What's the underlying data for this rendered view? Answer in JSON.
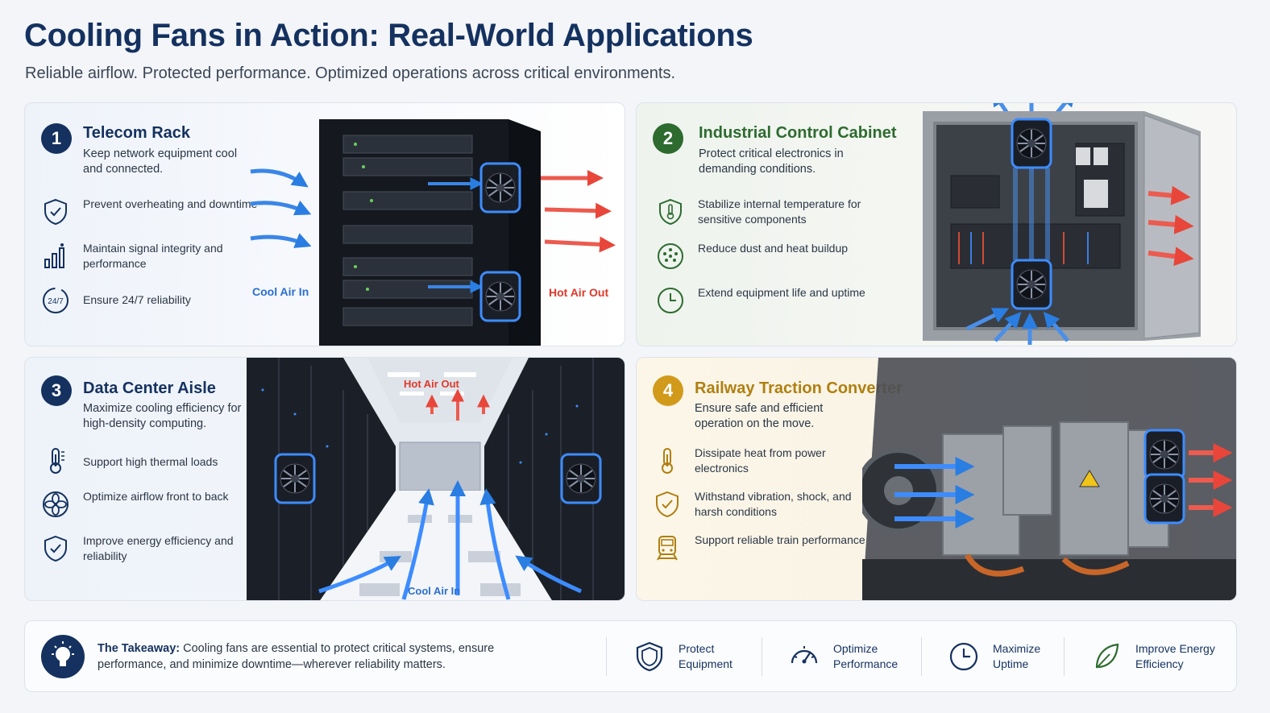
{
  "header": {
    "title": "Cooling Fans in Action: Real-World Applications",
    "subtitle": "Reliable airflow. Protected performance. Optimized operations across critical environments."
  },
  "cards": [
    {
      "number": "1",
      "title": "Telecom Rack",
      "desc": "Keep network equipment cool and connected.",
      "features": [
        {
          "icon": "shield-check-icon",
          "text": "Prevent overheating and downtime"
        },
        {
          "icon": "signal-bars-icon",
          "text": "Maintain signal integrity and performance"
        },
        {
          "icon": "clock-247-icon",
          "text": "Ensure 24/7 reliability"
        }
      ],
      "labels": {
        "cool": "Cool Air In",
        "hot": "Hot Air Out"
      },
      "accent": "#14315f"
    },
    {
      "number": "2",
      "title": "Industrial Control Cabinet",
      "desc": "Protect critical electronics in demanding conditions.",
      "features": [
        {
          "icon": "shield-thermometer-icon",
          "text": "Stabilize internal temperature for sensitive components"
        },
        {
          "icon": "dust-icon",
          "text": "Reduce dust and heat buildup"
        },
        {
          "icon": "clock-icon",
          "text": "Extend equipment life and uptime"
        }
      ],
      "accent": "#2d6b2f"
    },
    {
      "number": "3",
      "title": "Data Center Aisle",
      "desc": "Maximize cooling efficiency for high-density computing.",
      "features": [
        {
          "icon": "thermometer-icon",
          "text": "Support high thermal loads"
        },
        {
          "icon": "fan-icon",
          "text": "Optimize airflow front to back"
        },
        {
          "icon": "shield-check-icon",
          "text": "Improve energy efficiency and reliability"
        }
      ],
      "labels": {
        "cool": "Cool Air In",
        "hot": "Hot Air Out"
      },
      "accent": "#14315f"
    },
    {
      "number": "4",
      "title": "Railway Traction Converter",
      "desc": "Ensure safe and efficient operation on the move.",
      "features": [
        {
          "icon": "thermometer-icon",
          "text": "Dissipate heat from power electronics"
        },
        {
          "icon": "shield-check-icon",
          "text": "Withstand vibration, shock, and harsh conditions"
        },
        {
          "icon": "train-icon",
          "text": "Support reliable train performance"
        }
      ],
      "accent": "#d29a1b"
    }
  ],
  "footer": {
    "takeaway_label": "The Takeaway:",
    "takeaway_text": "Cooling fans are essential to protect critical systems, ensure performance, and minimize downtime—wherever reliability matters.",
    "items": [
      {
        "icon": "shield-icon",
        "line1": "Protect",
        "line2": "Equipment"
      },
      {
        "icon": "gauge-icon",
        "line1": "Optimize",
        "line2": "Performance"
      },
      {
        "icon": "clock-icon",
        "line1": "Maximize",
        "line2": "Uptime"
      },
      {
        "icon": "leaf-icon",
        "line1": "Improve Energy",
        "line2": "Efficiency"
      }
    ]
  },
  "colors": {
    "cool_air": "#2a7de1",
    "hot_air": "#e8463a",
    "fan_glow": "#3d8cff"
  }
}
